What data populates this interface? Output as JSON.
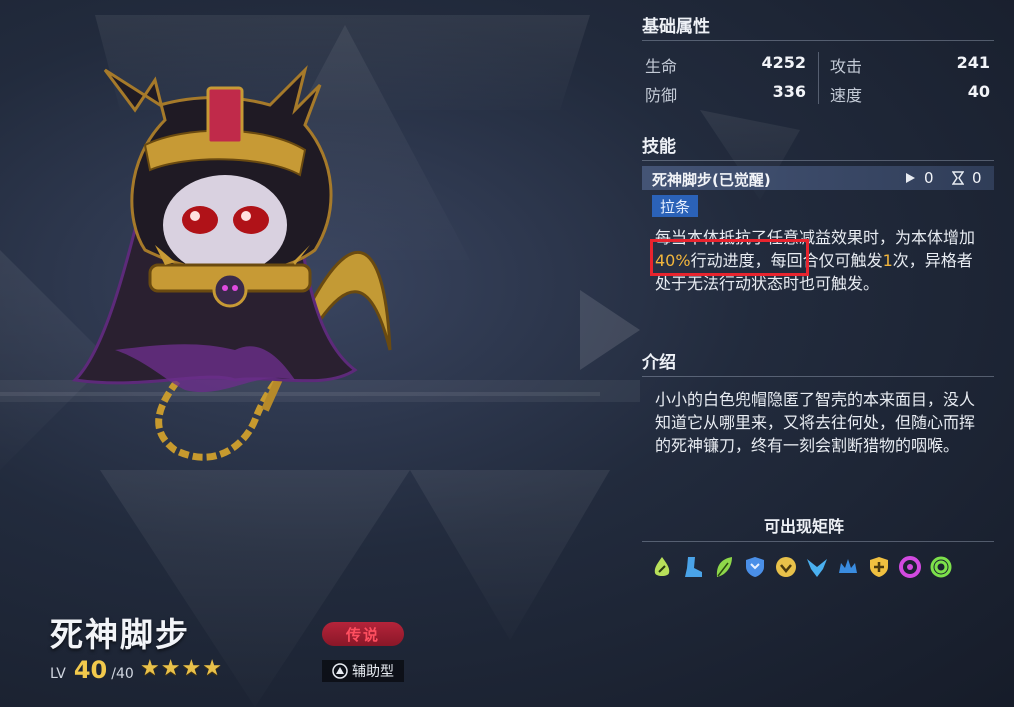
{
  "character": {
    "name": "死神脚步",
    "level_label": "LV",
    "level": "40",
    "level_max": "/40",
    "stars": [
      "★",
      "★",
      "★",
      "★"
    ],
    "rarity": "传说",
    "role": "辅助型"
  },
  "basic_stats": {
    "title": "基础属性",
    "items": [
      {
        "label": "生命",
        "value": "4252"
      },
      {
        "label": "攻击",
        "value": "241"
      },
      {
        "label": "防御",
        "value": "336"
      },
      {
        "label": "速度",
        "value": "40"
      }
    ]
  },
  "skills": {
    "title": "技能",
    "skill_name": "死神脚步(已觉醒)",
    "play_count": "0",
    "hourglass_count": "0",
    "tag": "拉条",
    "desc_part1": "每当本体抵抗了任意减益效果时，为本体",
    "desc_part2": "增加",
    "desc_highlight": "40%",
    "desc_part3": "行动进度，每回合仅可触发",
    "desc_highlight2": "1",
    "desc_part4": "次，异格者处于无法行动状态时也可触发。"
  },
  "intro": {
    "title": "介绍",
    "text": "小小的白色兜帽隐匿了智壳的本来面目，没人知道它从哪里来，又将去往何处，但随心而挥的死神镰刀，终有一刻会割断猎物的咽喉。"
  },
  "formation": {
    "title": "可出现矩阵",
    "icons": [
      {
        "name": "leaf-drop-icon",
        "color": "#b8e05a"
      },
      {
        "name": "boot-icon",
        "color": "#4aa3e8"
      },
      {
        "name": "feather-icon",
        "color": "#8ed84a"
      },
      {
        "name": "blue-shield-icon",
        "color": "#4a8fe8"
      },
      {
        "name": "gold-crest-icon",
        "color": "#e8c14a"
      },
      {
        "name": "blue-wings-icon",
        "color": "#4ab0f0"
      },
      {
        "name": "blue-crown-icon",
        "color": "#3a8ce0"
      },
      {
        "name": "gold-shield-icon",
        "color": "#f0c040"
      },
      {
        "name": "purple-ring-icon",
        "color": "#d24ae0"
      },
      {
        "name": "green-ring-icon",
        "color": "#7ce04a"
      }
    ]
  }
}
